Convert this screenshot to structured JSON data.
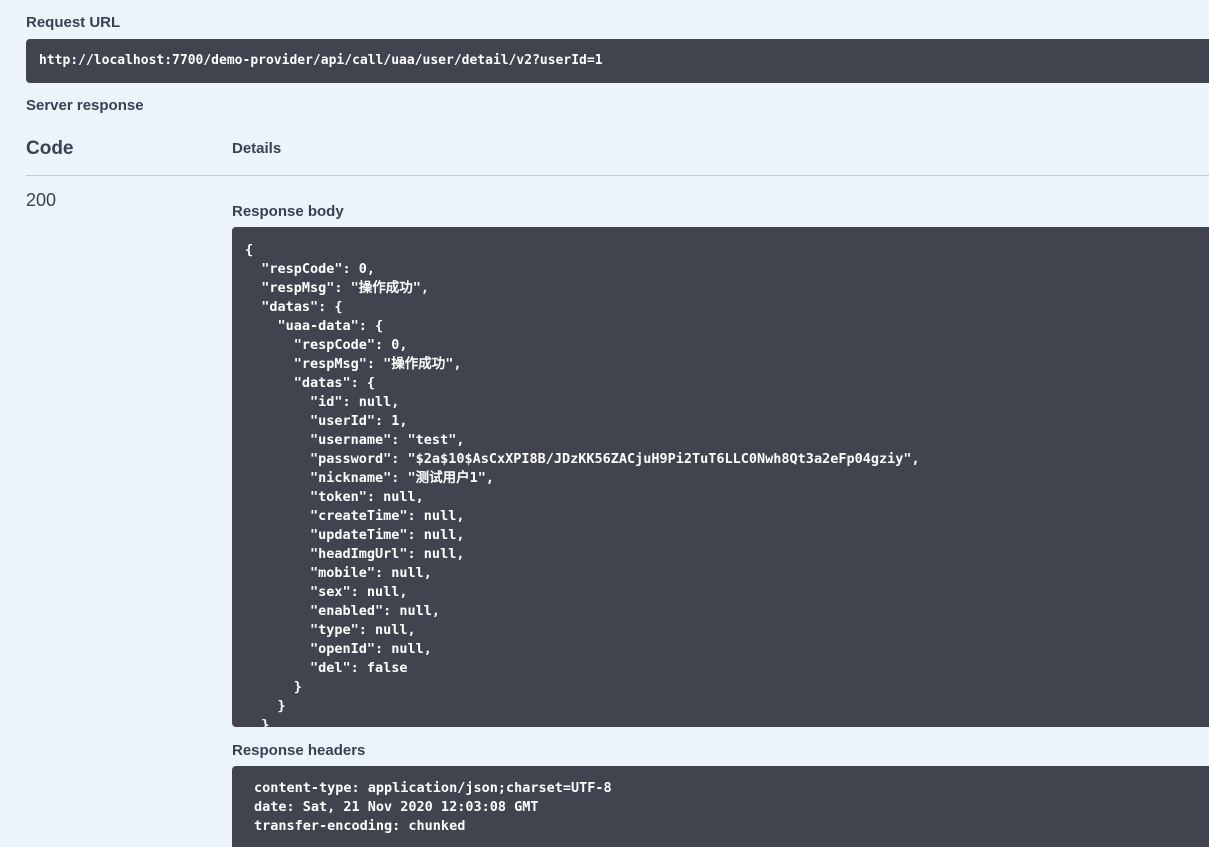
{
  "request_url": {
    "label": "Request URL",
    "value": "http://localhost:7700/demo-provider/api/call/uaa/user/detail/v2?userId=1"
  },
  "server_response": {
    "label": "Server response",
    "columns": {
      "code": "Code",
      "details": "Details"
    },
    "code": "200",
    "response_body": {
      "label": "Response body",
      "content": "{\n  \"respCode\": 0,\n  \"respMsg\": \"操作成功\",\n  \"datas\": {\n    \"uaa-data\": {\n      \"respCode\": 0,\n      \"respMsg\": \"操作成功\",\n      \"datas\": {\n        \"id\": null,\n        \"userId\": 1,\n        \"username\": \"test\",\n        \"password\": \"$2a$10$AsCxXPI8B/JDzKK56ZACjuH9Pi2TuT6LLC0Nwh8Qt3a2eFp04gziy\",\n        \"nickname\": \"测试用户1\",\n        \"token\": null,\n        \"createTime\": null,\n        \"updateTime\": null,\n        \"headImgUrl\": null,\n        \"mobile\": null,\n        \"sex\": null,\n        \"enabled\": null,\n        \"type\": null,\n        \"openId\": null,\n        \"del\": false\n      }\n    }\n  }\n}"
    },
    "response_headers": {
      "label": "Response headers",
      "content": "content-type: application/json;charset=UTF-8\ndate: Sat, 21 Nov 2020 12:03:08 GMT\ntransfer-encoding: chunked"
    }
  }
}
